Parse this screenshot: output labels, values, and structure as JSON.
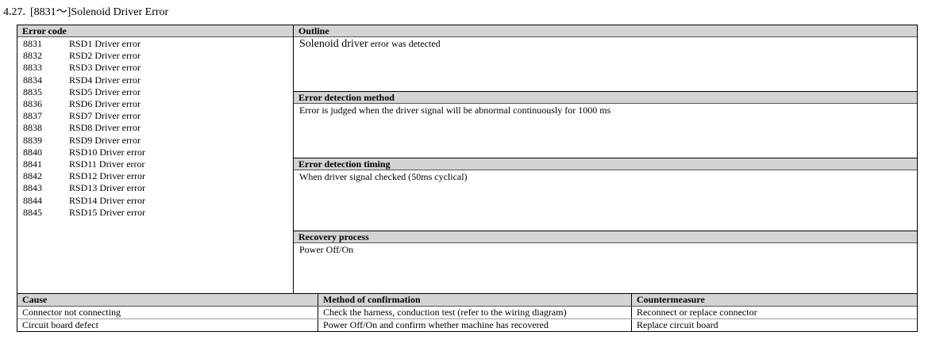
{
  "title": {
    "number": "4.27.",
    "text": "[8831～]Solenoid Driver Error"
  },
  "left": {
    "header": "Error  code",
    "codes": [
      {
        "code": "8831",
        "label": "RSD1  Driver  error"
      },
      {
        "code": "8832",
        "label": "RSD2  Driver  error"
      },
      {
        "code": "8833",
        "label": "RSD3  Driver  error"
      },
      {
        "code": "8834",
        "label": "RSD4  Driver  error"
      },
      {
        "code": "8835",
        "label": "RSD5  Driver  error"
      },
      {
        "code": "8836",
        "label": "RSD6  Driver  error"
      },
      {
        "code": "8837",
        "label": "RSD7  Driver  error"
      },
      {
        "code": "8838",
        "label": "RSD8  Driver  error"
      },
      {
        "code": "8839",
        "label": "RSD9  Driver  error"
      },
      {
        "code": "8840",
        "label": "RSD10  Driver  error"
      },
      {
        "code": "8841",
        "label": "RSD11  Driver  error"
      },
      {
        "code": "8842",
        "label": "RSD12  Driver  error"
      },
      {
        "code": "8843",
        "label": "RSD13  Driver  error"
      },
      {
        "code": "8844",
        "label": "RSD14  Driver  error"
      },
      {
        "code": "8845",
        "label": "RSD15  Driver  error"
      }
    ]
  },
  "outline": {
    "header": "Outline",
    "text_large": "Solenoid  driver",
    "text_small": " error  was  detected"
  },
  "detection_method": {
    "header": "Error  detection  method",
    "text": "Error  is  judged  when  the  driver  signal  will  be  abnormal  continuously  for  1000  ms"
  },
  "detection_timing": {
    "header": "Error  detection  timing",
    "text": "When  driver  signal  checked  (50ms  cyclical)"
  },
  "recovery": {
    "header": "Recovery  process",
    "text": "Power  Off/On"
  },
  "bottom": {
    "headers": {
      "cause": "Cause",
      "method": "Method  of  confirmation",
      "countermeasure": "Countermeasure"
    },
    "rows": [
      {
        "cause": "Connector  not  connecting",
        "method": "Check  the  harness,  conduction  test  (refer  to  the  wiring  diagram)",
        "countermeasure": "Reconnect  or  replace  connector"
      },
      {
        "cause": "Circuit  board  defect",
        "method": "Power  Off/On  and  confirm  whether  machine  has  recovered",
        "countermeasure": "Replace  circuit  board"
      }
    ]
  }
}
